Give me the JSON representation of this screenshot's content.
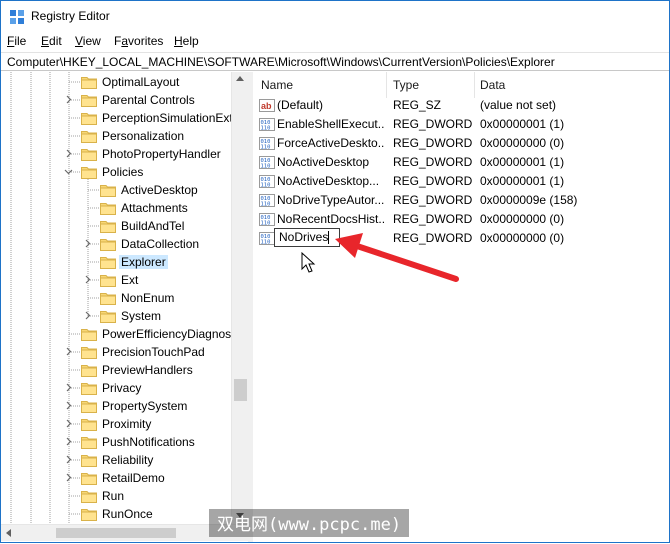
{
  "window": {
    "title": "Registry Editor",
    "accent": "#1e73c8"
  },
  "menu": [
    {
      "label": "File",
      "key": "F"
    },
    {
      "label": "Edit",
      "key": "E"
    },
    {
      "label": "View",
      "key": "V"
    },
    {
      "label": "Favorites",
      "key": "a"
    },
    {
      "label": "Help",
      "key": "H"
    }
  ],
  "address": "Computer\\HKEY_LOCAL_MACHINE\\SOFTWARE\\Microsoft\\Windows\\CurrentVersion\\Policies\\Explorer",
  "tree": [
    {
      "label": "OptimalLayout",
      "level": 0,
      "expandable": false,
      "expanded": false,
      "selected": false
    },
    {
      "label": "Parental Controls",
      "level": 0,
      "expandable": true,
      "expanded": false,
      "selected": false
    },
    {
      "label": "PerceptionSimulationExt",
      "level": 0,
      "expandable": false,
      "expanded": false,
      "selected": false
    },
    {
      "label": "Personalization",
      "level": 0,
      "expandable": false,
      "expanded": false,
      "selected": false
    },
    {
      "label": "PhotoPropertyHandler",
      "level": 0,
      "expandable": true,
      "expanded": false,
      "selected": false
    },
    {
      "label": "Policies",
      "level": 0,
      "expandable": true,
      "expanded": true,
      "selected": false
    },
    {
      "label": "ActiveDesktop",
      "level": 1,
      "expandable": false,
      "expanded": false,
      "selected": false
    },
    {
      "label": "Attachments",
      "level": 1,
      "expandable": false,
      "expanded": false,
      "selected": false
    },
    {
      "label": "BuildAndTel",
      "level": 1,
      "expandable": false,
      "expanded": false,
      "selected": false
    },
    {
      "label": "DataCollection",
      "level": 1,
      "expandable": true,
      "expanded": false,
      "selected": false
    },
    {
      "label": "Explorer",
      "level": 1,
      "expandable": false,
      "expanded": false,
      "selected": true
    },
    {
      "label": "Ext",
      "level": 1,
      "expandable": true,
      "expanded": false,
      "selected": false
    },
    {
      "label": "NonEnum",
      "level": 1,
      "expandable": false,
      "expanded": false,
      "selected": false
    },
    {
      "label": "System",
      "level": 1,
      "expandable": true,
      "expanded": false,
      "selected": false
    },
    {
      "label": "PowerEfficiencyDiagnost",
      "level": 0,
      "expandable": false,
      "expanded": false,
      "selected": false
    },
    {
      "label": "PrecisionTouchPad",
      "level": 0,
      "expandable": true,
      "expanded": false,
      "selected": false
    },
    {
      "label": "PreviewHandlers",
      "level": 0,
      "expandable": false,
      "expanded": false,
      "selected": false
    },
    {
      "label": "Privacy",
      "level": 0,
      "expandable": true,
      "expanded": false,
      "selected": false
    },
    {
      "label": "PropertySystem",
      "level": 0,
      "expandable": true,
      "expanded": false,
      "selected": false
    },
    {
      "label": "Proximity",
      "level": 0,
      "expandable": true,
      "expanded": false,
      "selected": false
    },
    {
      "label": "PushNotifications",
      "level": 0,
      "expandable": true,
      "expanded": false,
      "selected": false
    },
    {
      "label": "Reliability",
      "level": 0,
      "expandable": true,
      "expanded": false,
      "selected": false
    },
    {
      "label": "RetailDemo",
      "level": 0,
      "expandable": true,
      "expanded": false,
      "selected": false
    },
    {
      "label": "Run",
      "level": 0,
      "expandable": false,
      "expanded": false,
      "selected": false
    },
    {
      "label": "RunOnce",
      "level": 0,
      "expandable": false,
      "expanded": false,
      "selected": false
    }
  ],
  "columns": {
    "name": "Name",
    "type": "Type",
    "data": "Data"
  },
  "values": [
    {
      "name": "(Default)",
      "type": "REG_SZ",
      "data": "(value not set)",
      "icon": "string-value-icon"
    },
    {
      "name": "EnableShellExecut...",
      "type": "REG_DWORD",
      "data": "0x00000001 (1)",
      "icon": "binary-value-icon"
    },
    {
      "name": "ForceActiveDeskto...",
      "type": "REG_DWORD",
      "data": "0x00000000 (0)",
      "icon": "binary-value-icon"
    },
    {
      "name": "NoActiveDesktop",
      "type": "REG_DWORD",
      "data": "0x00000001 (1)",
      "icon": "binary-value-icon"
    },
    {
      "name": "NoActiveDesktop...",
      "type": "REG_DWORD",
      "data": "0x00000001 (1)",
      "icon": "binary-value-icon"
    },
    {
      "name": "NoDriveTypeAutor...",
      "type": "REG_DWORD",
      "data": "0x0000009e (158)",
      "icon": "binary-value-icon"
    },
    {
      "name": "NoRecentDocsHist...",
      "type": "REG_DWORD",
      "data": "0x00000000 (0)",
      "icon": "binary-value-icon"
    },
    {
      "name": "NoDrives",
      "type": "REG_DWORD",
      "data": "0x00000000 (0)",
      "icon": "binary-value-icon",
      "editing": true
    }
  ],
  "annotation": {
    "color": "#e8262b"
  },
  "watermark": "双电网(www.pcpc.me)"
}
